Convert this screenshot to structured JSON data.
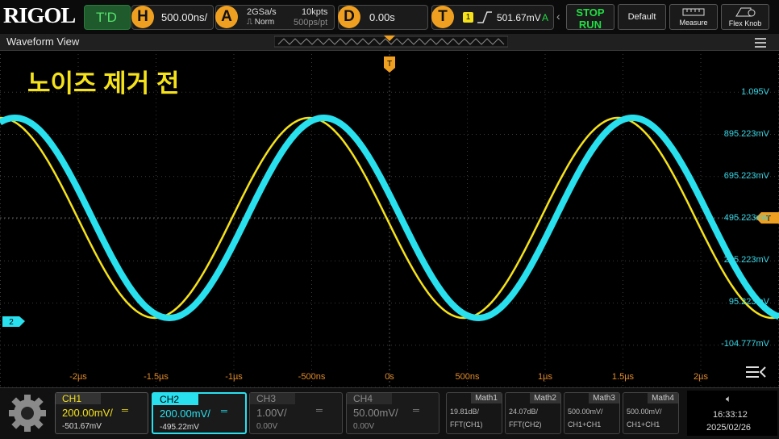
{
  "brand": {
    "logo": "RIGOL"
  },
  "top": {
    "trigger_status": "T'D",
    "horizontal": {
      "badge": "H",
      "value": "500.00ns/"
    },
    "acquire": {
      "badge": "A",
      "sample_rate": "2GSa/s",
      "mode": "Norm",
      "memory": "10kpts",
      "per_point": "500ps/pt"
    },
    "delay": {
      "badge": "D",
      "value": "0.00s"
    },
    "trigger": {
      "badge": "T",
      "channel": "1",
      "level": "501.67mV",
      "mode": "A"
    },
    "buttons": {
      "stop": "STOP",
      "run": "RUN",
      "default": "Default",
      "measure": "Measure",
      "flexknob": "Flex Knob"
    }
  },
  "waveform_view": {
    "title": "Waveform View",
    "annotation": "노이즈 제거 전",
    "trigger_marker": "T",
    "ch2_marker": "2",
    "trigger_level_marker": "T"
  },
  "y_labels": [
    "1.095V",
    "895.223mV",
    "695.223mV",
    "495.223mV",
    "295.223mV",
    "95.223mV",
    "-104.777mV"
  ],
  "x_labels": [
    "-2µs",
    "-1.5µs",
    "-1µs",
    "-500ns",
    "0s",
    "500ns",
    "1µs",
    "1.5µs",
    "2µs"
  ],
  "channels": [
    {
      "name": "CH1",
      "scale": "200.00mV/",
      "offset": "-501.67mV",
      "color": "#f5e21a"
    },
    {
      "name": "CH2",
      "scale": "200.00mV/",
      "offset": "-495.22mV",
      "color": "#28e0ee"
    },
    {
      "name": "CH3",
      "scale": "1.00V/",
      "offset": "0.00V",
      "color": "#8a8a8a"
    },
    {
      "name": "CH4",
      "scale": "50.00mV/",
      "offset": "0.00V",
      "color": "#8a8a8a"
    }
  ],
  "math": [
    {
      "name": "Math1",
      "line1": "19.81dB/",
      "line2": "FFT(CH1)"
    },
    {
      "name": "Math2",
      "line1": "24.07dB/",
      "line2": "FFT(CH2)"
    },
    {
      "name": "Math3",
      "line1": "500.00mV/",
      "line2": "CH1+CH1"
    },
    {
      "name": "Math4",
      "line1": "500.00mV/",
      "line2": "CH1+CH1"
    }
  ],
  "status": {
    "time": "16:33:12",
    "date": "2025/02/26"
  },
  "colors": {
    "ch1": "#f5e21a",
    "ch2": "#28e0ee",
    "accent": "#f0a020",
    "green": "#22dd44"
  }
}
